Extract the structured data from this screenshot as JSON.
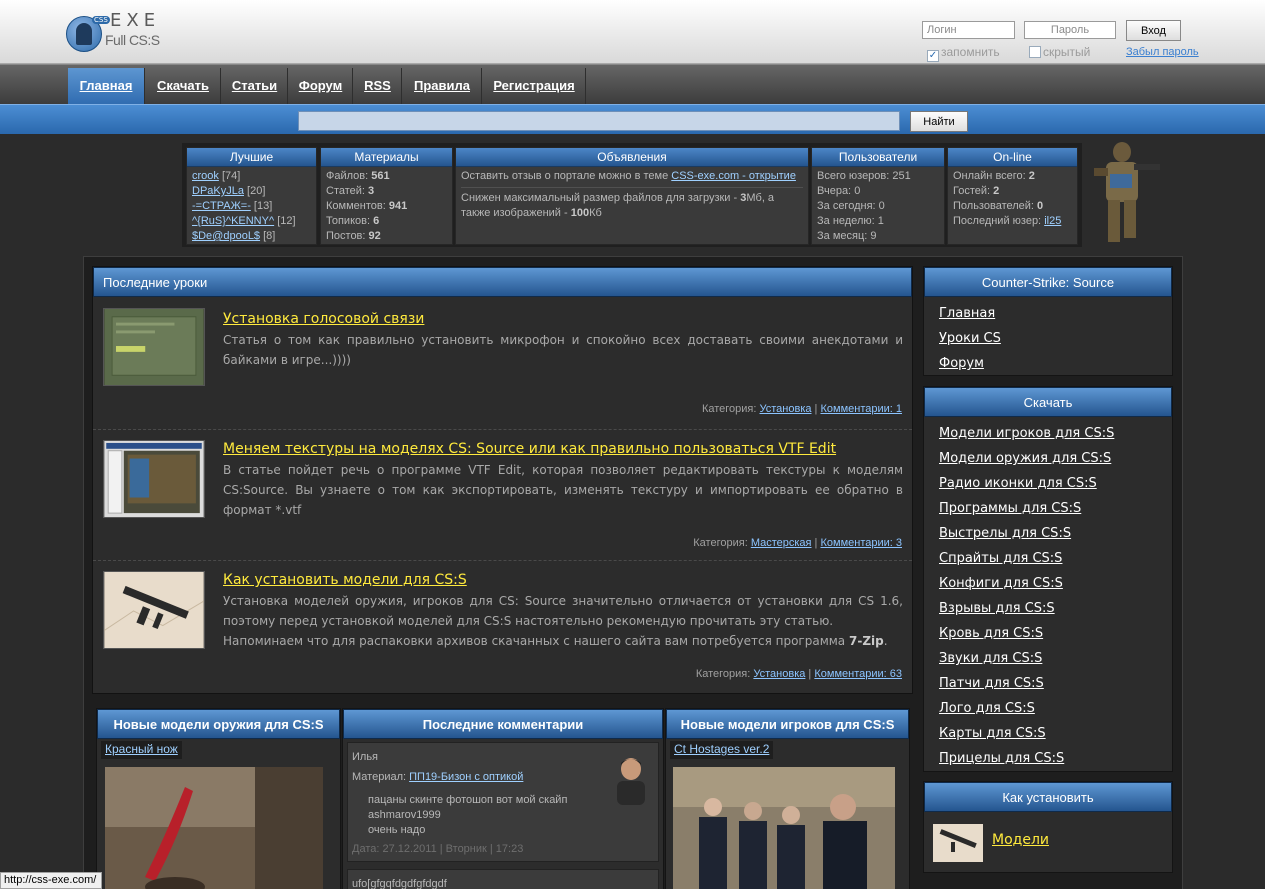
{
  "header": {
    "logo_top": "EXE",
    "logo_bottom": "Full CS:S",
    "logo_badge": "CSS",
    "login_placeholder": "Логин",
    "password_placeholder": "Пароль",
    "login_button": "Вход",
    "remember_label": "запомнить",
    "hidden_label": "скрытый",
    "forgot_link": "Забыл пароль"
  },
  "nav": {
    "items": [
      {
        "label": "Главная",
        "active": true
      },
      {
        "label": "Скачать"
      },
      {
        "label": "Статьи"
      },
      {
        "label": "Форум"
      },
      {
        "label": "RSS"
      },
      {
        "label": "Правила"
      },
      {
        "label": "Регистрация"
      }
    ]
  },
  "search": {
    "button": "Найти"
  },
  "stats": {
    "best": {
      "title": "Лучшие",
      "users": [
        {
          "name": "crook",
          "score": "[74]"
        },
        {
          "name": "DPaKyJLa",
          "score": "[20]"
        },
        {
          "name": "-=CTPAЖ=-",
          "score": "[13]"
        },
        {
          "name": "^{RuS}^KENNY^",
          "score": "[12]"
        },
        {
          "name": "$De@dpooL$",
          "score": "[8]"
        }
      ]
    },
    "materials": {
      "title": "Материалы",
      "rows": [
        {
          "label": "Файлов:",
          "value": "561"
        },
        {
          "label": "Статей:",
          "value": "3"
        },
        {
          "label": "Комментов:",
          "value": "941"
        },
        {
          "label": "Топиков:",
          "value": "6"
        },
        {
          "label": "Постов:",
          "value": "92"
        }
      ]
    },
    "announcements": {
      "title": "Объявления",
      "item1_text": "Оставить отзыв о портале можно в теме",
      "item1_link": "CSS-exe.com - открытие",
      "item2_pre": "Снижен максимальный размер файлов для загрузки -",
      "item2_val1": "3",
      "item2_mid": "Мб, а также изображений -",
      "item2_val2": "100",
      "item2_post": "Кб"
    },
    "users": {
      "title": "Пользователи",
      "rows": [
        {
          "label": "Всего юзеров:",
          "value": "251"
        },
        {
          "label": "Вчера:",
          "value": "0"
        },
        {
          "label": "За сегодня:",
          "value": "0"
        },
        {
          "label": "За неделю:",
          "value": "1"
        },
        {
          "label": "За месяц:",
          "value": "9"
        }
      ]
    },
    "online": {
      "title": "On-line",
      "total_label": "Онлайн всего:",
      "total_value": "2",
      "guests_label": "Гостей:",
      "guests_value": "2",
      "members_label": "Пользователей:",
      "members_value": "0",
      "last_label": "Последний юзер:",
      "last_value": "il25"
    }
  },
  "lessons": {
    "title": "Последние уроки",
    "items": [
      {
        "title": "Установка голосовой связи",
        "text": "Статья о том как правильно установить микрофон и спокойно всех доставать своими анекдотами и байками в игре...))))",
        "category_label": "Категория:",
        "category": "Установка",
        "comments": "Комментарии: 1"
      },
      {
        "title": "Меняем текстуры на моделях CS: Source или как правильно пользоваться VTF Edit",
        "text": "В статье пойдет речь о программе VTF Edit, которая позволяет редактировать текстуры к моделям CS:Source. Вы узнаете о том как экспортировать, изменять текстуру и импортировать ее обратно в формат *.vtf",
        "category_label": "Категория:",
        "category": "Мастерская",
        "comments": "Комментарии: 3"
      },
      {
        "title": "Как установить модели для CS:S",
        "text": "Установка моделей оружия, игроков для CS: Source значительно отличается от установки для CS 1.6, поэтому перед установкой моделей для CS:S настоятельно рекомендую прочитать эту статью.",
        "text2_pre": "Напоминаем что для распаковки архивов скачанных с нашего сайта вам потребуется программа",
        "text2_bold": "7-Zip",
        "text2_post": ".",
        "category_label": "Категория:",
        "category": "Установка",
        "comments": "Комментарии: 63"
      }
    ]
  },
  "bottom": {
    "weapons": {
      "title": "Новые модели оружия для CS:S",
      "item": "Красный нож"
    },
    "comments": {
      "title": "Последние комментарии",
      "c1": {
        "author": "Илья",
        "material_label": "Материал:",
        "material": "ПП19-Бизон с оптикой",
        "line1": "пацаны скинте фотошоп вот мой скайп",
        "line2": "ashmarov1999",
        "line3": "очень надо",
        "date": "Дата: 27.12.2011 | Вторник | 17:23"
      },
      "c2": {
        "author": "ufo[gfgqfdgdfgfdgdf"
      }
    },
    "players": {
      "title": "Новые модели игроков для CS:S",
      "item": "Ct Hostages ver.2"
    }
  },
  "sidebar": {
    "css": {
      "title": "Counter-Strike: Source",
      "links": [
        "Главная",
        "Уроки CS",
        "Форум"
      ]
    },
    "download": {
      "title": "Скачать",
      "links": [
        "Модели игроков для CS:S",
        "Модели оружия для CS:S",
        "Радио иконки для CS:S",
        "Программы для CS:S",
        "Выстрелы для CS:S",
        "Спрайты для CS:S",
        "Конфиги для CS:S",
        "Взрывы для CS:S",
        "Кровь для CS:S",
        "Звуки для CS:S",
        "Патчи для CS:S",
        "Лого для CS:S",
        "Карты для CS:S",
        "Прицелы для CS:S"
      ]
    },
    "howto": {
      "title": "Как установить",
      "item": "Модели"
    }
  },
  "statusbar": {
    "url": "http://css-exe.com/"
  }
}
